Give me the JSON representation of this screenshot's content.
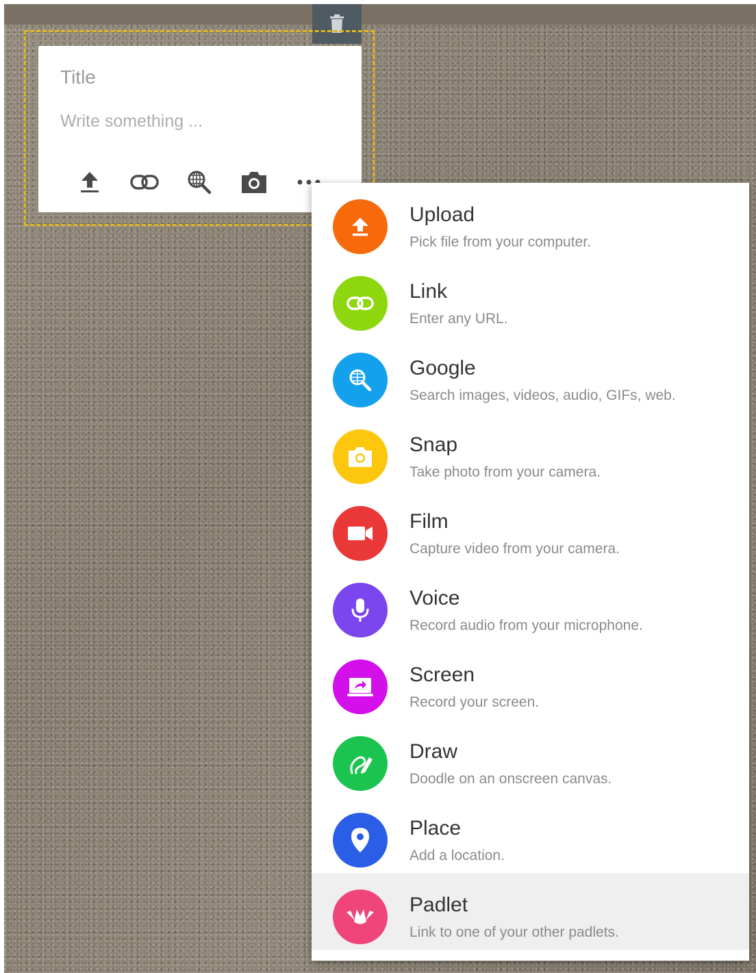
{
  "post": {
    "title_placeholder": "Title",
    "body_placeholder": "Write something ..."
  },
  "toolbar": {
    "buttons": [
      "upload-icon",
      "link-icon",
      "google-search-icon",
      "camera-icon",
      "more-icon"
    ]
  },
  "menu": {
    "items": [
      {
        "label": "Upload",
        "description": "Pick file from your computer.",
        "icon": "upload-icon",
        "color": "#f76a0c"
      },
      {
        "label": "Link",
        "description": "Enter any URL.",
        "icon": "link-icon",
        "color": "#8ed70f"
      },
      {
        "label": "Google",
        "description": "Search images, videos, audio, GIFs, web.",
        "icon": "google-search-icon",
        "color": "#13a1ee"
      },
      {
        "label": "Snap",
        "description": "Take photo from your camera.",
        "icon": "camera-icon",
        "color": "#fdc70e"
      },
      {
        "label": "Film",
        "description": "Capture video from your camera.",
        "icon": "video-camera-icon",
        "color": "#ea3737"
      },
      {
        "label": "Voice",
        "description": "Record audio from your microphone.",
        "icon": "microphone-icon",
        "color": "#7c46ee"
      },
      {
        "label": "Screen",
        "description": "Record your screen.",
        "icon": "screen-record-icon",
        "color": "#d410ea"
      },
      {
        "label": "Draw",
        "description": "Doodle on an onscreen canvas.",
        "icon": "draw-pen-icon",
        "color": "#1bc44f"
      },
      {
        "label": "Place",
        "description": "Add a location.",
        "icon": "location-pin-icon",
        "color": "#2b5ee6"
      },
      {
        "label": "Padlet",
        "description": "Link to one of your other padlets.",
        "icon": "padlet-logo-icon",
        "color": "#f0457a"
      }
    ]
  }
}
